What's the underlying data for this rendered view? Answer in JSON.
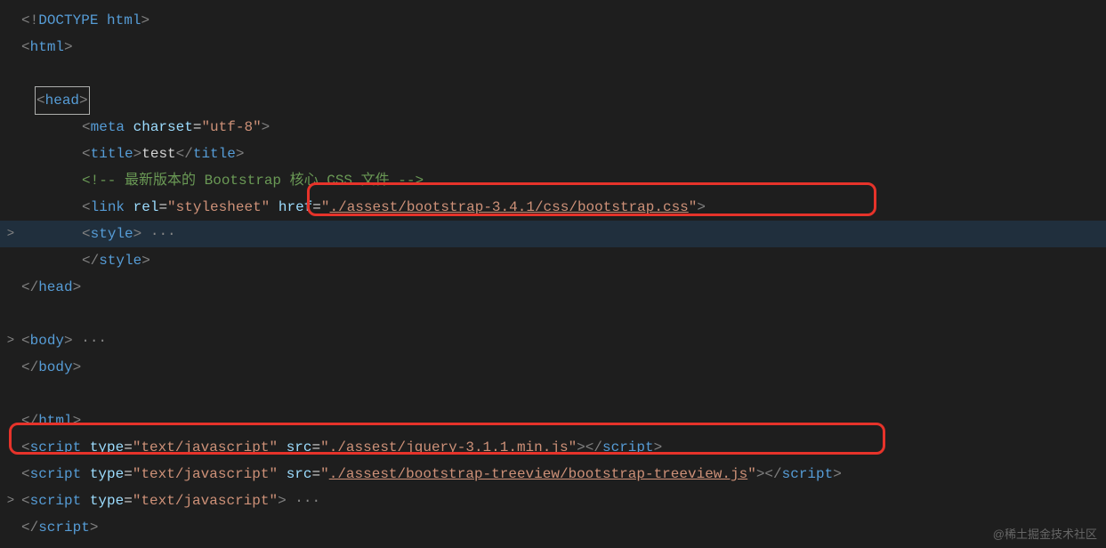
{
  "code": {
    "line1": {
      "doctype_lt": "<",
      "doctype_bang": "!",
      "doctype_kw": "DOCTYPE",
      "doctype_sp": " ",
      "doctype_name": "html",
      "doctype_gt": ">"
    },
    "line2": {
      "lt": "<",
      "tag": "html",
      "gt": ">"
    },
    "line4": {
      "lt": "<",
      "tag": "head",
      "gt": ">"
    },
    "line5": {
      "lt": "<",
      "tag": "meta",
      "sp1": " ",
      "attr1": "charset",
      "eq1": "=",
      "val1": "\"utf-8\"",
      "gt": ">"
    },
    "line6": {
      "lt": "<",
      "tag": "title",
      "gt": ">",
      "text": "test",
      "lt2": "</",
      "tag2": "title",
      "gt2": ">"
    },
    "line7": {
      "comment": "<!-- 最新版本的 Bootstrap 核心 CSS 文件 -->"
    },
    "line8": {
      "lt": "<",
      "tag": "link",
      "sp1": " ",
      "attr1": "rel",
      "eq1": "=",
      "val1": "\"stylesheet\"",
      "sp2": " ",
      "attr2": "href",
      "eq2": "=",
      "val2q": "\"",
      "val2": "./assest/bootstrap-3.4.1/css/bootstrap.css",
      "val2q2": "\"",
      "gt": ">"
    },
    "line9": {
      "lt": "<",
      "tag": "style",
      "gt": ">",
      "dots": " ···"
    },
    "line10": {
      "lt": "</",
      "tag": "style",
      "gt": ">"
    },
    "line11": {
      "lt": "</",
      "tag": "head",
      "gt": ">"
    },
    "line13": {
      "lt": "<",
      "tag": "body",
      "gt": ">",
      "dots": " ···"
    },
    "line14": {
      "lt": "</",
      "tag": "body",
      "gt": ">"
    },
    "line16": {
      "lt": "</",
      "tag": "html",
      "gt": ">"
    },
    "line17": {
      "lt": "<",
      "tag": "script",
      "sp1": " ",
      "attr1": "type",
      "eq1": "=",
      "val1": "\"text/javascript\"",
      "sp2": " ",
      "attr2": "src",
      "eq2": "=",
      "val2q": "\"",
      "val2": "./assest/jquery-3.1.1.min.js",
      "val2q2": "\"",
      "gt": ">",
      "lt2": "</",
      "tag2": "script",
      "gt2": ">"
    },
    "line18": {
      "lt": "<",
      "tag": "script",
      "sp1": " ",
      "attr1": "type",
      "eq1": "=",
      "val1": "\"text/javascript\"",
      "sp2": " ",
      "attr2": "src",
      "eq2": "=",
      "val2q": "\"",
      "val2": "./assest/bootstrap-treeview/bootstrap-treeview.js",
      "val2q2": "\"",
      "gt": ">",
      "lt2": "</",
      "tag2": "script",
      "gt2": ">"
    },
    "line19": {
      "lt": "<",
      "tag": "script",
      "sp1": " ",
      "attr1": "type",
      "eq1": "=",
      "val1": "\"text/javascript\"",
      "gt": ">",
      "dots": " ···"
    },
    "line20": {
      "lt": "</",
      "tag": "script",
      "gt": ">"
    }
  },
  "fold_marker": ">",
  "watermark": "@稀土掘金技术社区"
}
